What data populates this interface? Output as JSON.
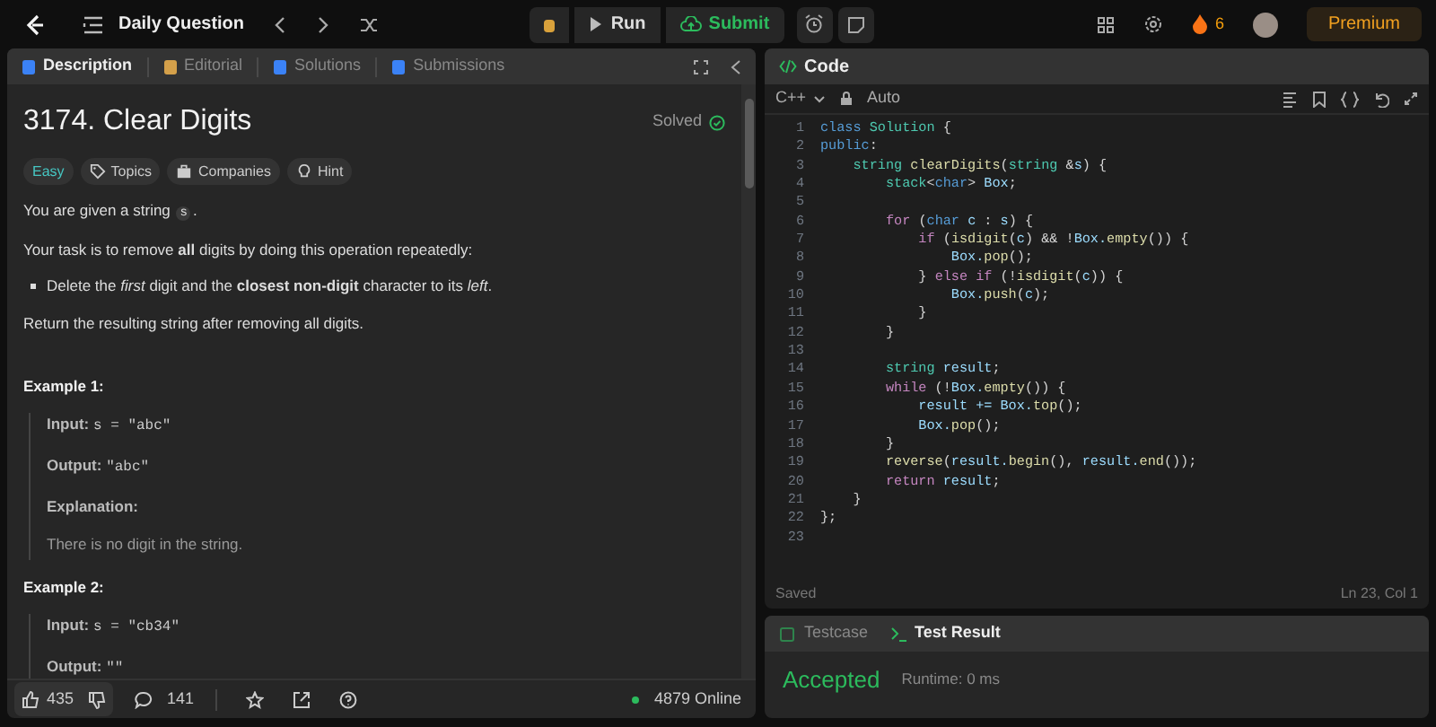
{
  "topbar": {
    "title": "Daily Question",
    "run": "Run",
    "submit": "Submit",
    "streak": "6",
    "premium": "Premium"
  },
  "left_tabs": [
    {
      "label": "Description",
      "selected": true,
      "color": "#3b82f6"
    },
    {
      "label": "Editorial",
      "selected": false,
      "color": "#d4a04a"
    },
    {
      "label": "Solutions",
      "selected": false,
      "color": "#3b82f6"
    },
    {
      "label": "Submissions",
      "selected": false,
      "color": "#3b82f6"
    }
  ],
  "problem": {
    "title": "3174. Clear Digits",
    "status": "Solved",
    "difficulty": "Easy",
    "tags": [
      {
        "kind": "topics",
        "label": "Topics"
      },
      {
        "kind": "companies",
        "label": "Companies"
      },
      {
        "kind": "hint",
        "label": "Hint"
      }
    ],
    "paragraphs": [
      {
        "kind": "text",
        "before": "You are given a string ",
        "code": "s",
        "after": "."
      },
      {
        "kind": "text",
        "text": "Your task is to remove **all** digits by doing this operation repeatedly:"
      },
      {
        "kind": "bullet",
        "text": "Delete the *first* digit and the **closest non-digit** character to its *left*."
      },
      {
        "kind": "text",
        "text": "Return the resulting string after removing all digits."
      }
    ],
    "examples": [
      {
        "title": "Example 1:",
        "rows": [
          {
            "kind": "field",
            "label": "Input:",
            "value": "s = \"abc\""
          },
          {
            "kind": "field",
            "label": "Output:",
            "value": "\"abc\""
          },
          {
            "kind": "heading",
            "label": "Explanation:"
          },
          {
            "kind": "note",
            "text": "There is no digit in the string."
          }
        ]
      },
      {
        "title": "Example 2:",
        "rows": [
          {
            "kind": "field",
            "label": "Input:",
            "value": "s = \"cb34\""
          },
          {
            "kind": "field",
            "label": "Output:",
            "value": "\"\""
          }
        ]
      }
    ]
  },
  "footer": {
    "likes": "435",
    "comments": "141",
    "online": "4879 Online"
  },
  "code_panel": {
    "title": "Code",
    "language": "C++",
    "mode": "Auto",
    "status": "Saved",
    "cursor": "Ln 23, Col 1",
    "lines": [
      {
        "num": "1",
        "tokens": [
          {
            "t": "class ",
            "color": "#569cd6"
          },
          {
            "t": "Solution",
            "color": "#4ec9b0"
          },
          {
            "t": " {",
            "color": "#d4d4d4"
          }
        ]
      },
      {
        "num": "2",
        "tokens": [
          {
            "t": "public",
            "color": "#569cd6"
          },
          {
            "t": ":",
            "color": "#d4d4d4"
          }
        ]
      },
      {
        "num": "3",
        "tokens": [
          {
            "t": "    string ",
            "color": "#4ec9b0"
          },
          {
            "t": "clearDigits",
            "color": "#dcdcaa"
          },
          {
            "t": "(",
            "color": "#d4d4d4"
          },
          {
            "t": "string",
            "color": "#4ec9b0"
          },
          {
            "t": " &",
            "color": "#d4d4d4"
          },
          {
            "t": "s",
            "color": "#9cdcfe"
          },
          {
            "t": ") {",
            "color": "#d4d4d4"
          }
        ]
      },
      {
        "num": "4",
        "tokens": [
          {
            "t": "        stack",
            "color": "#4ec9b0"
          },
          {
            "t": "<",
            "color": "#d4d4d4"
          },
          {
            "t": "char",
            "color": "#569cd6"
          },
          {
            "t": "> ",
            "color": "#d4d4d4"
          },
          {
            "t": "Box",
            "color": "#9cdcfe"
          },
          {
            "t": ";",
            "color": "#d4d4d4"
          }
        ]
      },
      {
        "num": "5"
      },
      {
        "num": "6",
        "tokens": [
          {
            "t": "        for",
            "color": "#c586c0"
          },
          {
            "t": " (",
            "color": "#d4d4d4"
          },
          {
            "t": "char ",
            "color": "#569cd6"
          },
          {
            "t": "c",
            "color": "#9cdcfe"
          },
          {
            "t": " : ",
            "color": "#d4d4d4"
          },
          {
            "t": "s",
            "color": "#9cdcfe"
          },
          {
            "t": ") {",
            "color": "#d4d4d4"
          }
        ]
      },
      {
        "num": "7",
        "tokens": [
          {
            "t": "            if",
            "color": "#c586c0"
          },
          {
            "t": " (",
            "color": "#d4d4d4"
          },
          {
            "t": "isdigit",
            "color": "#dcdcaa"
          },
          {
            "t": "(",
            "color": "#d4d4d4"
          },
          {
            "t": "c",
            "color": "#9cdcfe"
          },
          {
            "t": ") && !",
            "color": "#d4d4d4"
          },
          {
            "t": "Box.",
            "color": "#9cdcfe"
          },
          {
            "t": "empty",
            "color": "#dcdcaa"
          },
          {
            "t": "()) {",
            "color": "#d4d4d4"
          }
        ]
      },
      {
        "num": "8",
        "tokens": [
          {
            "t": "                Box.",
            "color": "#9cdcfe"
          },
          {
            "t": "pop",
            "color": "#dcdcaa"
          },
          {
            "t": "();",
            "color": "#d4d4d4"
          }
        ]
      },
      {
        "num": "9",
        "tokens": [
          {
            "t": "            } ",
            "color": "#d4d4d4"
          },
          {
            "t": "else if",
            "color": "#c586c0"
          },
          {
            "t": " (!",
            "color": "#d4d4d4"
          },
          {
            "t": "isdigit",
            "color": "#dcdcaa"
          },
          {
            "t": "(",
            "color": "#d4d4d4"
          },
          {
            "t": "c",
            "color": "#9cdcfe"
          },
          {
            "t": ")) {",
            "color": "#d4d4d4"
          }
        ]
      },
      {
        "num": "10",
        "tokens": [
          {
            "t": "                Box.",
            "color": "#9cdcfe"
          },
          {
            "t": "push",
            "color": "#dcdcaa"
          },
          {
            "t": "(",
            "color": "#d4d4d4"
          },
          {
            "t": "c",
            "color": "#9cdcfe"
          },
          {
            "t": ");",
            "color": "#d4d4d4"
          }
        ]
      },
      {
        "num": "11",
        "tokens": [
          {
            "t": "            }",
            "color": "#d4d4d4"
          }
        ]
      },
      {
        "num": "12",
        "tokens": [
          {
            "t": "        }",
            "color": "#d4d4d4"
          }
        ]
      },
      {
        "num": "13"
      },
      {
        "num": "14",
        "tokens": [
          {
            "t": "        string ",
            "color": "#4ec9b0"
          },
          {
            "t": "result",
            "color": "#9cdcfe"
          },
          {
            "t": ";",
            "color": "#d4d4d4"
          }
        ]
      },
      {
        "num": "15",
        "tokens": [
          {
            "t": "        while",
            "color": "#c586c0"
          },
          {
            "t": " (!",
            "color": "#d4d4d4"
          },
          {
            "t": "Box.",
            "color": "#9cdcfe"
          },
          {
            "t": "empty",
            "color": "#dcdcaa"
          },
          {
            "t": "()) {",
            "color": "#d4d4d4"
          }
        ]
      },
      {
        "num": "16",
        "tokens": [
          {
            "t": "            result += Box.",
            "color": "#9cdcfe"
          },
          {
            "t": "top",
            "color": "#dcdcaa"
          },
          {
            "t": "();",
            "color": "#d4d4d4"
          }
        ]
      },
      {
        "num": "17",
        "tokens": [
          {
            "t": "            Box.",
            "color": "#9cdcfe"
          },
          {
            "t": "pop",
            "color": "#dcdcaa"
          },
          {
            "t": "();",
            "color": "#d4d4d4"
          }
        ]
      },
      {
        "num": "18",
        "tokens": [
          {
            "t": "        }",
            "color": "#d4d4d4"
          }
        ]
      },
      {
        "num": "19",
        "tokens": [
          {
            "t": "        reverse",
            "color": "#dcdcaa"
          },
          {
            "t": "(",
            "color": "#d4d4d4"
          },
          {
            "t": "result.",
            "color": "#9cdcfe"
          },
          {
            "t": "begin",
            "color": "#dcdcaa"
          },
          {
            "t": "(), ",
            "color": "#d4d4d4"
          },
          {
            "t": "result.",
            "color": "#9cdcfe"
          },
          {
            "t": "end",
            "color": "#dcdcaa"
          },
          {
            "t": "());",
            "color": "#d4d4d4"
          }
        ]
      },
      {
        "num": "20",
        "tokens": [
          {
            "t": "        return ",
            "color": "#c586c0"
          },
          {
            "t": "result",
            "color": "#9cdcfe"
          },
          {
            "t": ";",
            "color": "#d4d4d4"
          }
        ]
      },
      {
        "num": "21",
        "tokens": [
          {
            "t": "    }",
            "color": "#d4d4d4"
          }
        ]
      },
      {
        "num": "22",
        "tokens": [
          {
            "t": "};",
            "color": "#d4d4d4"
          }
        ]
      },
      {
        "num": "23"
      }
    ]
  },
  "test_panel": {
    "tabs": [
      {
        "label": "Testcase",
        "selected": false
      },
      {
        "label": "Test Result",
        "selected": true
      }
    ],
    "verdict": "Accepted",
    "runtime": "Runtime: 0 ms"
  }
}
